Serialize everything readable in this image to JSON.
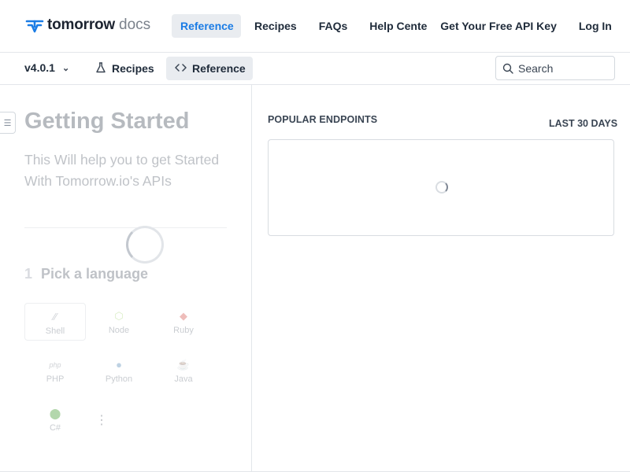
{
  "header": {
    "brand": "tomorrow",
    "brand_suffix": "docs",
    "nav": {
      "reference": "Reference",
      "recipes": "Recipes",
      "faqs": "FAQs",
      "help_center": "Help Cente",
      "api_key": "Get Your Free API Key",
      "login": "Log In"
    },
    "active_tab": "Reference",
    "accent_color": "#1b7ce5"
  },
  "subheader": {
    "version": "v4.0.1",
    "tabs": {
      "recipes": "Recipes",
      "reference": "Reference"
    },
    "search_placeholder": "Search"
  },
  "main": {
    "title": "Getting Started",
    "subtitle": "This Will help you to get Started With Tomorrow.io's APIs",
    "step_number": "1",
    "step_title": "Pick a language",
    "languages": [
      {
        "label": "Shell",
        "icon": "shell-icon",
        "selected": true
      },
      {
        "label": "Node",
        "icon": "node-icon",
        "selected": false
      },
      {
        "label": "Ruby",
        "icon": "ruby-icon",
        "selected": false
      },
      {
        "label": "PHP",
        "icon": "php-icon",
        "selected": false
      },
      {
        "label": "Python",
        "icon": "python-icon",
        "selected": false
      },
      {
        "label": "Java",
        "icon": "java-icon",
        "selected": false
      },
      {
        "label": "C#",
        "icon": "csharp-icon",
        "selected": false
      }
    ]
  },
  "endpoints": {
    "label": "POPULAR ENDPOINTS",
    "range": "LAST 30 DAYS"
  }
}
